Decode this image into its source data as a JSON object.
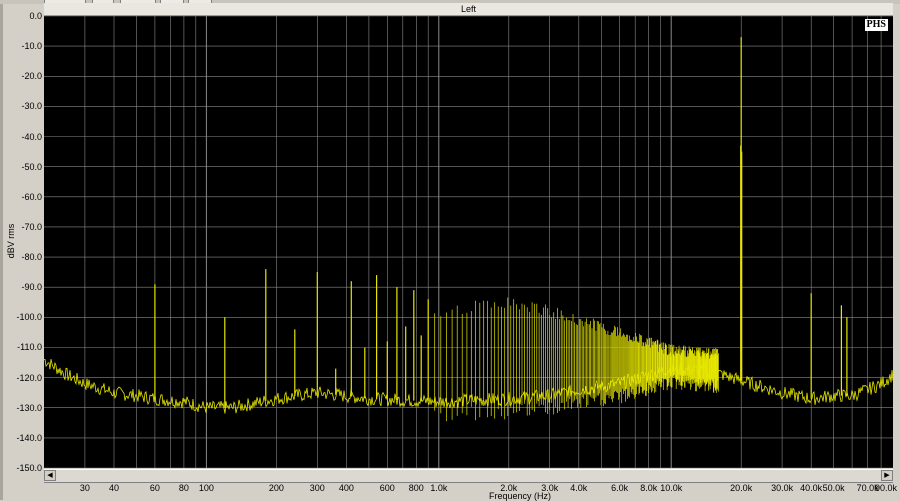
{
  "window": {
    "channel_title": "Left",
    "logo_text": "PHS"
  },
  "colors": {
    "trace": "#e6e600",
    "grid": "#8a8a8a",
    "background": "#000000"
  },
  "icons": {
    "scroll_left": "left-arrow-icon",
    "scroll_right": "right-arrow-icon"
  },
  "chart_data": {
    "type": "line",
    "title": "Left",
    "xlabel": "Frequency (Hz)",
    "ylabel": "dBV rms",
    "xscale": "log",
    "xlim": [
      20,
      90000
    ],
    "ylim": [
      -150,
      0
    ],
    "grid": true,
    "yticks": [
      0,
      -10,
      -20,
      -30,
      -40,
      -50,
      -60,
      -70,
      -80,
      -90,
      -100,
      -110,
      -120,
      -130,
      -140,
      -150
    ],
    "ytick_labels": [
      "0.0",
      "-10.0",
      "-20.0",
      "-30.0",
      "-40.0",
      "-50.0",
      "-60.0",
      "-70.0",
      "-80.0",
      "-90.0",
      "-100.0",
      "-110.0",
      "-120.0",
      "-130.0",
      "-140.0",
      "-150.0"
    ],
    "xticks": [
      30,
      40,
      60,
      80,
      100,
      200,
      300,
      400,
      600,
      800,
      1000,
      2000,
      3000,
      4000,
      6000,
      8000,
      10000,
      20000,
      30000,
      40000,
      50000,
      70000,
      90000
    ],
    "xtick_labels": [
      "30",
      "40",
      "60",
      "80",
      "100",
      "200",
      "300",
      "400",
      "600",
      "800",
      "1.0k",
      "2.0k",
      "3.0k",
      "4.0k",
      "6.0k",
      "8.0k",
      "10.0k",
      "20.0k",
      "30.0k",
      "40.0k",
      "50.0k",
      "70.0k",
      "90.0k"
    ],
    "series": [
      {
        "noise_floor": [
          [
            20,
            -114
          ],
          [
            25,
            -119
          ],
          [
            30,
            -122
          ],
          [
            40,
            -125
          ],
          [
            50,
            -126
          ],
          [
            60,
            -127
          ],
          [
            80,
            -128
          ],
          [
            100,
            -130
          ],
          [
            130,
            -130
          ],
          [
            200,
            -127
          ],
          [
            300,
            -125
          ],
          [
            500,
            -127
          ],
          [
            1000,
            -128
          ],
          [
            2000,
            -127
          ],
          [
            3000,
            -126
          ],
          [
            4000,
            -124
          ],
          [
            6000,
            -122
          ],
          [
            8000,
            -119
          ],
          [
            10000,
            -117
          ],
          [
            15000,
            -118
          ],
          [
            20000,
            -121
          ],
          [
            30000,
            -125
          ],
          [
            40000,
            -127
          ],
          [
            50000,
            -126
          ],
          [
            60000,
            -126
          ],
          [
            70000,
            -124
          ],
          [
            80000,
            -122
          ],
          [
            90000,
            -119
          ]
        ],
        "spurs": [
          {
            "x": 60,
            "y": -89
          },
          {
            "x": 120,
            "y": -100
          },
          {
            "x": 180,
            "y": -84
          },
          {
            "x": 240,
            "y": -104
          },
          {
            "x": 300,
            "y": -85
          },
          {
            "x": 360,
            "y": -117
          },
          {
            "x": 420,
            "y": -88
          },
          {
            "x": 480,
            "y": -110
          },
          {
            "x": 540,
            "y": -86
          },
          {
            "x": 600,
            "y": -108
          },
          {
            "x": 660,
            "y": -90
          },
          {
            "x": 720,
            "y": -103
          },
          {
            "x": 780,
            "y": -91
          },
          {
            "x": 840,
            "y": -106
          },
          {
            "x": 900,
            "y": -94
          },
          {
            "x": 19900,
            "y": -43
          },
          {
            "x": 20000,
            "y": -7
          },
          {
            "x": 20100,
            "y": -45
          },
          {
            "x": 40000,
            "y": -92
          },
          {
            "x": 54000,
            "y": -96
          },
          {
            "x": 57000,
            "y": -100
          }
        ],
        "harmonic_comb": {
          "start": 960,
          "end": 16000,
          "step": 60,
          "peak_envelope": [
            [
              960,
              -96
            ],
            [
              2000,
              -93
            ],
            [
              3000,
              -96
            ],
            [
              6000,
              -103
            ],
            [
              10000,
              -109
            ],
            [
              16000,
              -110
            ]
          ]
        }
      }
    ]
  }
}
